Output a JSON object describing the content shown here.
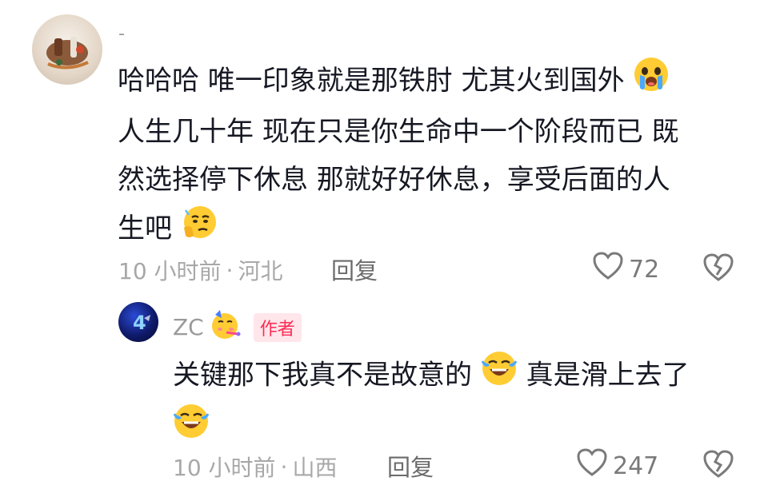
{
  "main_comment": {
    "username": "-",
    "text_lines": [
      "哈哈哈 唯一印象就是那铁肘 尤其火到国外",
      "人生几十年 现在只是你生命中一个阶段而已 既",
      "然选择停下休息 那就好好休息，享受后面的人",
      "生吧"
    ],
    "emojis": [
      "crying-face-emoji",
      "thinking-emoji"
    ],
    "time": "10 小时前",
    "separator": "·",
    "location": "河北",
    "reply_label": "回复",
    "likes": "72"
  },
  "reply_comment": {
    "username": "ZC",
    "username_emoji": "party-face-emoji",
    "author_badge": "作者",
    "text_line1": "关键那下我真不是故意的",
    "text_line1_tail": "真是滑上去了",
    "emojis": [
      "laughing-crying-emoji",
      "laughing-crying-emoji"
    ],
    "time": "10 小时前",
    "separator": "·",
    "location": "山西",
    "reply_label": "回复",
    "likes": "247"
  }
}
